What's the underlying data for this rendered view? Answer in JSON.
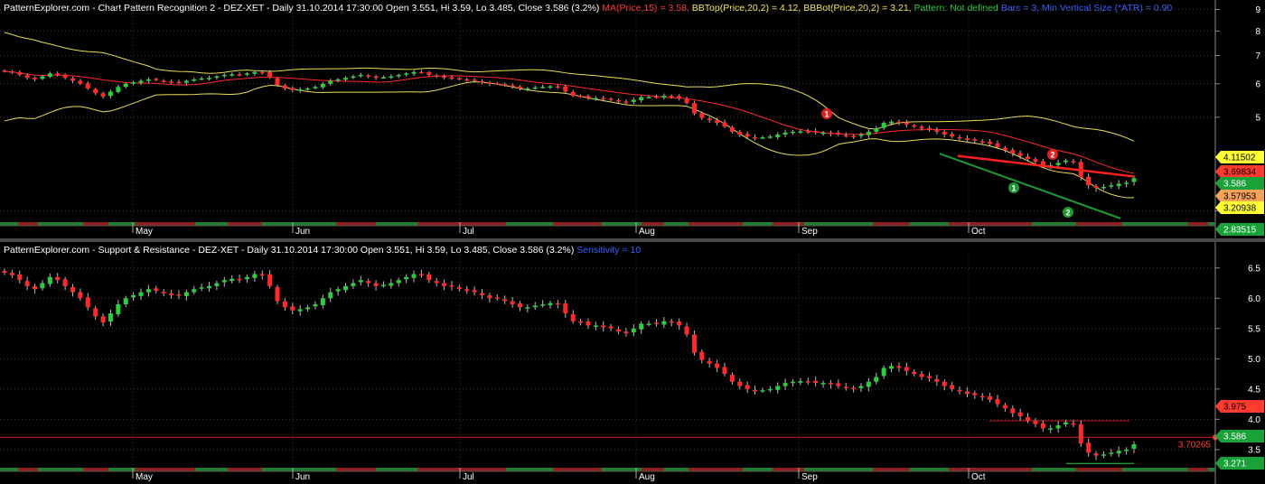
{
  "panes": [
    {
      "title_parts": [
        {
          "text": "PatternExplorer.com - Chart Pattern Recognition 2 - DEZ-XET - Daily 31.10.2014 17:30:00 Open 3.551, Hi 3.59, Lo 3.485, Close 3.586 (3.2%) ",
          "color": "#ffffff"
        },
        {
          "text": "MA(Price,15) = 3.58, ",
          "color": "#ff3b3b"
        },
        {
          "text": "BBTop(Price,20,2) = 4.12, ",
          "color": "#f2e85a"
        },
        {
          "text": "BBBot(Price,20,2) = 3.21, ",
          "color": "#f2e85a"
        },
        {
          "text": "Pattern: Not defined  ",
          "color": "#2ecc40"
        },
        {
          "text": "Bars = 3, Min Vertical Size (*ATR) = 0.90",
          "color": "#3a5fff"
        }
      ],
      "y_ticks": [
        "9",
        "8",
        "7",
        "6",
        "5",
        "3"
      ],
      "price_tags": [
        {
          "text": "4.11502",
          "bg": "#ffff33",
          "fg": "#000000",
          "value": 4.115
        },
        {
          "text": "3.69834",
          "bg": "#ff3b30",
          "fg": "#000000",
          "value": 3.698
        },
        {
          "text": "3.586",
          "bg": "#19a13a",
          "fg": "#ffffff",
          "value": 3.586
        },
        {
          "text": "3.57953",
          "bg": "#f6a35a",
          "fg": "#000000",
          "value": 3.48
        },
        {
          "text": "3.20938",
          "bg": "#ffff33",
          "fg": "#000000",
          "value": 3.209
        },
        {
          "text": "2.83515",
          "bg": "#19a13a",
          "fg": "#ffffff",
          "value": 2.835
        }
      ],
      "markers": [
        {
          "label": "1",
          "color": "#e02020"
        },
        {
          "label": "2",
          "color": "#e02020"
        },
        {
          "label": "1",
          "color": "#1f9a32"
        },
        {
          "label": "2",
          "color": "#1f9a32"
        }
      ]
    },
    {
      "title_parts": [
        {
          "text": "PatternExplorer.com - Support & Resistance - DEZ-XET - Daily 31.10.2014 17:30:00 Open 3.551, Hi 3.59, Lo 3.485, Close 3.586 (3.2%) ",
          "color": "#ffffff"
        },
        {
          "text": "Sensitivity = 10",
          "color": "#3a5fff"
        }
      ],
      "y_ticks": [
        "6.5",
        "6.0",
        "5.5",
        "5.0",
        "4.5",
        "4.0",
        "3.5"
      ],
      "price_tags": [
        {
          "text": "3.975",
          "bg": "#ff3b30",
          "fg": "#000000",
          "value": 3.975
        },
        {
          "text": "3.586",
          "bg": "#19a13a",
          "fg": "#ffffff",
          "value": 3.586
        },
        {
          "text": "3.271",
          "bg": "#19a13a",
          "fg": "#ffffff",
          "value": 3.271
        }
      ],
      "level_labels": [
        {
          "text": "3.70265",
          "color": "#ff3b30",
          "value": 3.70265
        }
      ]
    }
  ],
  "month_labels": [
    "May",
    "Jun",
    "Jul",
    "Aug",
    "Sep",
    "Oct"
  ],
  "chart_data": [
    {
      "type": "candlestick",
      "title": "PatternExplorer.com - Chart Pattern Recognition 2 - DEZ-XET",
      "xlabel": "",
      "ylabel": "",
      "ylim": [
        2.85,
        9.2
      ],
      "y_scale": "log",
      "series": [
        {
          "name": "MA(Price,15)",
          "color": "#ff3b3b"
        },
        {
          "name": "BBTop(Price,20,2)",
          "color": "#f2e85a"
        },
        {
          "name": "BBBot(Price,20,2)",
          "color": "#f2e85a"
        }
      ],
      "grid": true
    },
    {
      "type": "candlestick",
      "title": "PatternExplorer.com - Support & Resistance - DEZ-XET",
      "xlabel": "",
      "ylabel": "",
      "ylim": [
        3.2,
        6.75
      ],
      "support_resistance": [
        3.975,
        3.70265,
        3.271
      ],
      "grid": true
    }
  ],
  "candles": {
    "first_date": "2014-04-07",
    "last_date": "2014-10-31",
    "close": [
      6.42,
      6.38,
      6.3,
      6.2,
      6.15,
      6.25,
      6.35,
      6.3,
      6.2,
      6.1,
      6.0,
      5.85,
      5.7,
      5.6,
      5.75,
      5.9,
      6.0,
      6.05,
      6.1,
      6.15,
      6.12,
      6.08,
      6.05,
      6.05,
      6.1,
      6.15,
      6.18,
      6.2,
      6.25,
      6.3,
      6.32,
      6.3,
      6.35,
      6.4,
      6.38,
      6.2,
      5.95,
      5.85,
      5.8,
      5.82,
      5.85,
      5.9,
      6.0,
      6.1,
      6.15,
      6.2,
      6.25,
      6.3,
      6.25,
      6.2,
      6.22,
      6.25,
      6.3,
      6.35,
      6.4,
      6.38,
      6.3,
      6.25,
      6.2,
      6.2,
      6.15,
      6.12,
      6.1,
      6.05,
      6.0,
      6.0,
      5.95,
      5.9,
      5.85,
      5.85,
      5.88,
      5.9,
      5.92,
      5.9,
      5.75,
      5.62,
      5.6,
      5.55,
      5.55,
      5.52,
      5.5,
      5.45,
      5.42,
      5.5,
      5.58,
      5.58,
      5.58,
      5.62,
      5.6,
      5.55,
      5.4,
      5.1,
      4.98,
      4.92,
      4.85,
      4.75,
      4.62,
      4.55,
      4.5,
      4.48,
      4.48,
      4.5,
      4.55,
      4.6,
      4.62,
      4.63,
      4.62,
      4.6,
      4.6,
      4.58,
      4.55,
      4.52,
      4.5,
      4.55,
      4.62,
      4.7,
      4.85,
      4.88,
      4.85,
      4.8,
      4.75,
      4.7,
      4.68,
      4.62,
      4.55,
      4.5,
      4.46,
      4.42,
      4.4,
      4.38,
      4.32,
      4.25,
      4.18,
      4.1,
      4.05,
      3.98,
      3.92,
      3.85,
      3.85,
      3.9,
      3.95,
      3.92,
      3.6,
      3.45,
      3.4,
      3.42,
      3.45,
      3.48,
      3.5,
      3.586
    ]
  }
}
